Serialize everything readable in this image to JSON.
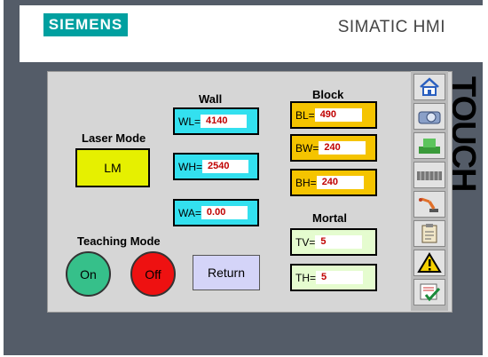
{
  "header": {
    "brand": "SIEMENS",
    "product": "SIMATIC HMI",
    "touch_label": "TOUCH"
  },
  "wall": {
    "title": "Wall",
    "wl": {
      "name": "WL=",
      "value": "4140"
    },
    "wh": {
      "name": "WH=",
      "value": "2540"
    },
    "wa": {
      "name": "WA=",
      "value": "0.00"
    }
  },
  "block": {
    "title": "Block",
    "bl": {
      "name": "BL=",
      "value": "490"
    },
    "bw": {
      "name": "BW=",
      "value": "240"
    },
    "bh": {
      "name": "BH=",
      "value": "240"
    }
  },
  "mortal": {
    "title": "Mortal",
    "tv": {
      "name": "TV=",
      "value": "5"
    },
    "th": {
      "name": "TH=",
      "value": "5"
    }
  },
  "laser": {
    "title": "Laser Mode",
    "button": "LM"
  },
  "teaching": {
    "title": "Teaching Mode",
    "on": "On",
    "off": "Off"
  },
  "return_label": "Return",
  "sidebar": [
    "home-icon",
    "camera-icon",
    "machine-icon",
    "conveyor-icon",
    "robot-arm-icon",
    "clipboard-icon",
    "warning-icon",
    "checklist-icon"
  ],
  "colors": {
    "cyan": "#33e0ef",
    "yellow": "#f5c400",
    "lime": "#e6f000",
    "green": "#36c08a",
    "red": "#ee1111",
    "lavender": "#d4d4f8",
    "pale_green": "#e5fccf"
  }
}
